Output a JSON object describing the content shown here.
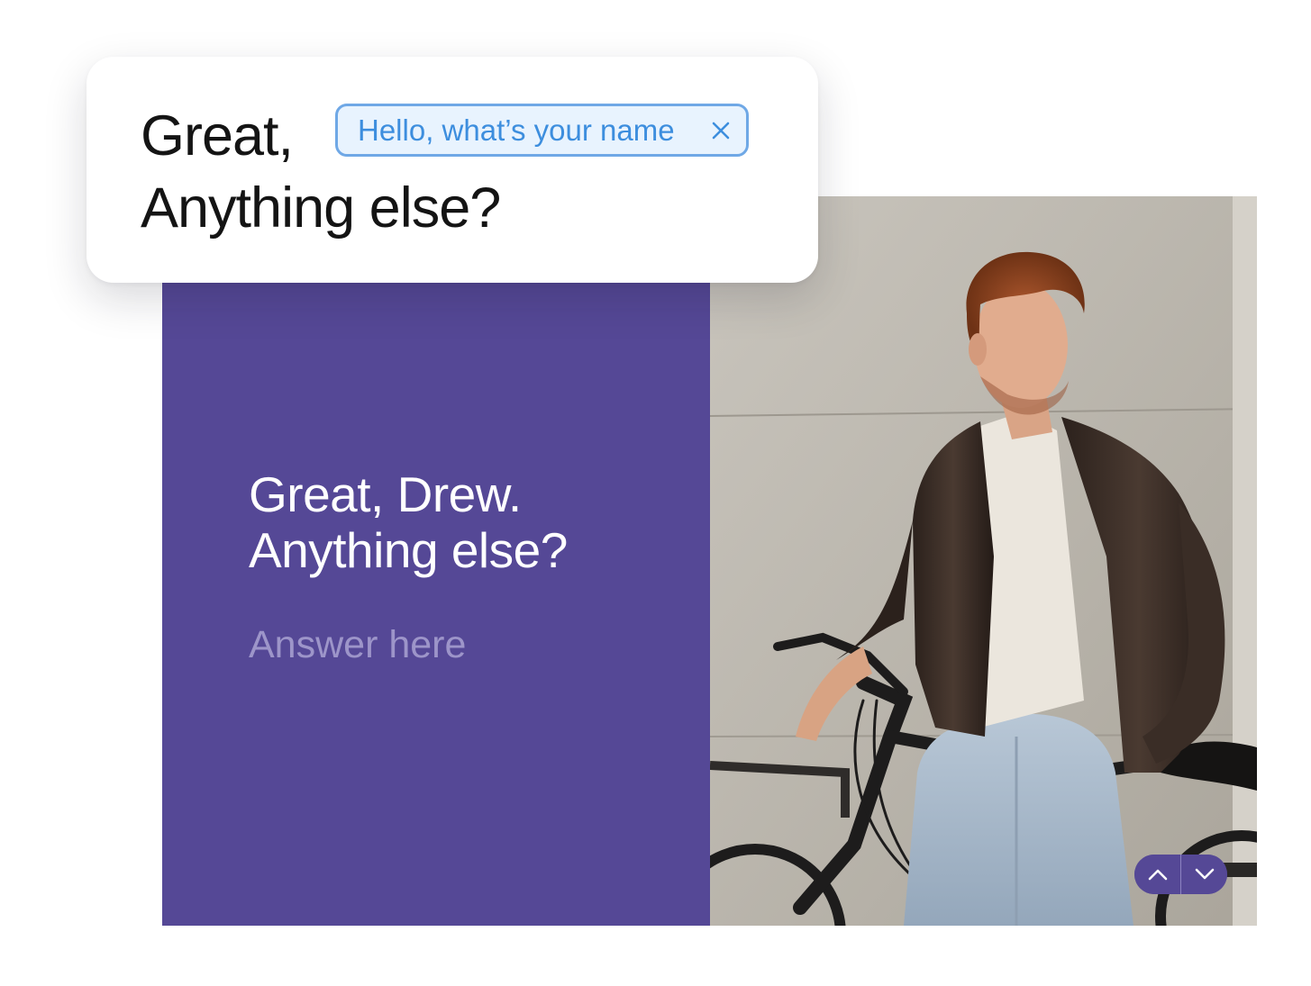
{
  "edit_card": {
    "line1": "Great,",
    "variable_chip": "Hello, what’s your name",
    "line2": "Anything else?"
  },
  "question": {
    "line1": "Great, Drew.",
    "line2": "Anything else?",
    "answer_placeholder": "Answer here"
  },
  "nav": {
    "up_icon": "chevron-up-icon",
    "down_icon": "chevron-down-icon"
  },
  "colors": {
    "accent": "#554896",
    "chip_border": "#6fa8e6",
    "chip_bg": "#e8f3fe",
    "chip_text": "#3d8ede"
  }
}
